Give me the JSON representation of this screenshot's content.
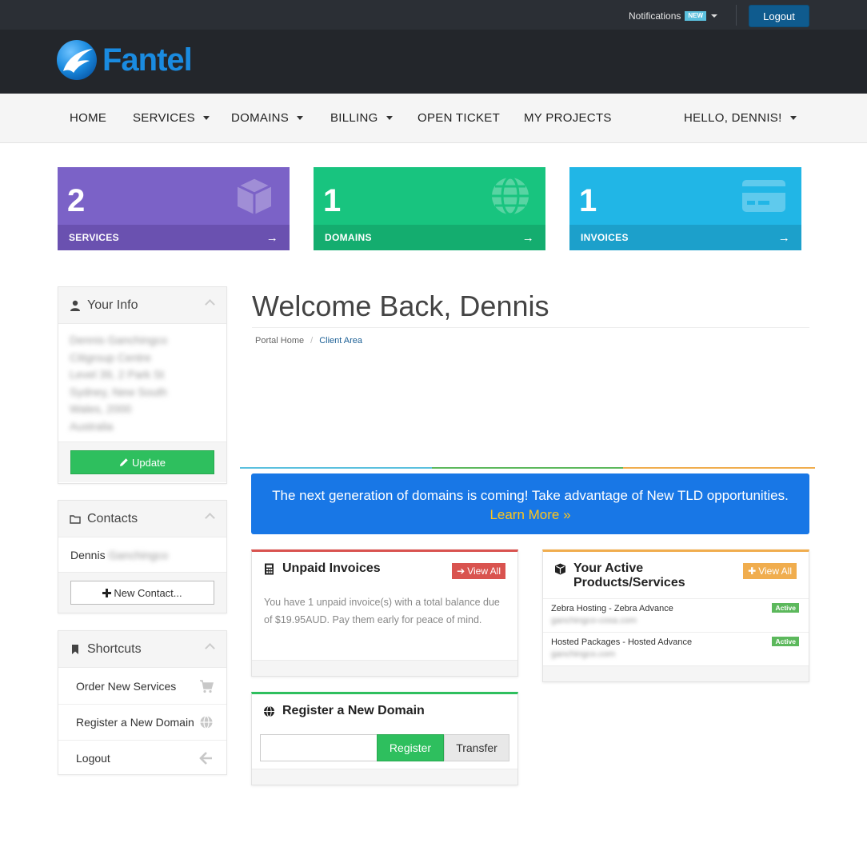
{
  "topbar": {
    "notifications_label": "Notifications",
    "notifications_badge": "NEW",
    "logout_label": "Logout"
  },
  "brand": {
    "name": "Fantel",
    "color": "#1a8be0"
  },
  "nav": {
    "items": [
      {
        "label": "HOME",
        "dropdown": false
      },
      {
        "label": "SERVICES",
        "dropdown": true
      },
      {
        "label": "DOMAINS",
        "dropdown": true
      },
      {
        "label": "BILLING",
        "dropdown": true
      },
      {
        "label": "OPEN TICKET",
        "dropdown": false
      },
      {
        "label": "MY PROJECTS",
        "dropdown": false
      }
    ],
    "user_greeting": "HELLO, DENNIS!"
  },
  "tiles": [
    {
      "count": "2",
      "label": "SERVICES",
      "icon": "cube-icon",
      "color": "#7b62c7",
      "foot_color": "#6a51b0",
      "arrow": "→"
    },
    {
      "count": "1",
      "label": "DOMAINS",
      "icon": "globe-icon",
      "color": "#18c47f",
      "foot_color": "#14ad6f",
      "arrow": "→"
    },
    {
      "count": "1",
      "label": "INVOICES",
      "icon": "credit-card-icon",
      "color": "#21b6e6",
      "foot_color": "#1ca0cb",
      "arrow": "→"
    }
  ],
  "sidebar": {
    "your_info": {
      "title": "Your Info",
      "lines": [
        "Dennis Ganchingco",
        "Citigroup Centre",
        "Level 39, 2 Park St",
        "Sydney, New South",
        "Wales, 2000",
        "Australia"
      ],
      "update_label": "Update"
    },
    "contacts": {
      "title": "Contacts",
      "first_name": "Dennis",
      "last_name": "Ganchingco",
      "new_contact_label": "New Contact..."
    },
    "shortcuts": {
      "title": "Shortcuts",
      "items": [
        {
          "label": "Order New Services",
          "icon": "cart-icon"
        },
        {
          "label": "Register a New Domain",
          "icon": "globe-icon"
        },
        {
          "label": "Logout",
          "icon": "arrow-left-icon"
        }
      ]
    }
  },
  "main": {
    "title": "Welcome Back, Dennis",
    "breadcrumb": {
      "home": "Portal Home",
      "current": "Client Area"
    },
    "promo": {
      "text": "The next generation of domains is coming! Take advantage of New TLD opportunities.",
      "link": "Learn More »"
    },
    "unpaid_invoices": {
      "title": "Unpaid Invoices",
      "view_all": "View All",
      "text": "You have 1 unpaid invoice(s) with a total balance due of $19.95AUD. Pay them early for peace of mind."
    },
    "active_products": {
      "title": "Your Active Products/Services",
      "view_all": "View All",
      "items": [
        {
          "name": "Zebra Hosting - Zebra Advance",
          "domain": "ganchingco-cosa.com",
          "status": "Active"
        },
        {
          "name": "Hosted Packages - Hosted Advance",
          "domain": "ganchingco.com",
          "status": "Active"
        }
      ]
    },
    "register_domain": {
      "title": "Register a New Domain",
      "input_value": "",
      "register_label": "Register",
      "transfer_label": "Transfer"
    }
  }
}
